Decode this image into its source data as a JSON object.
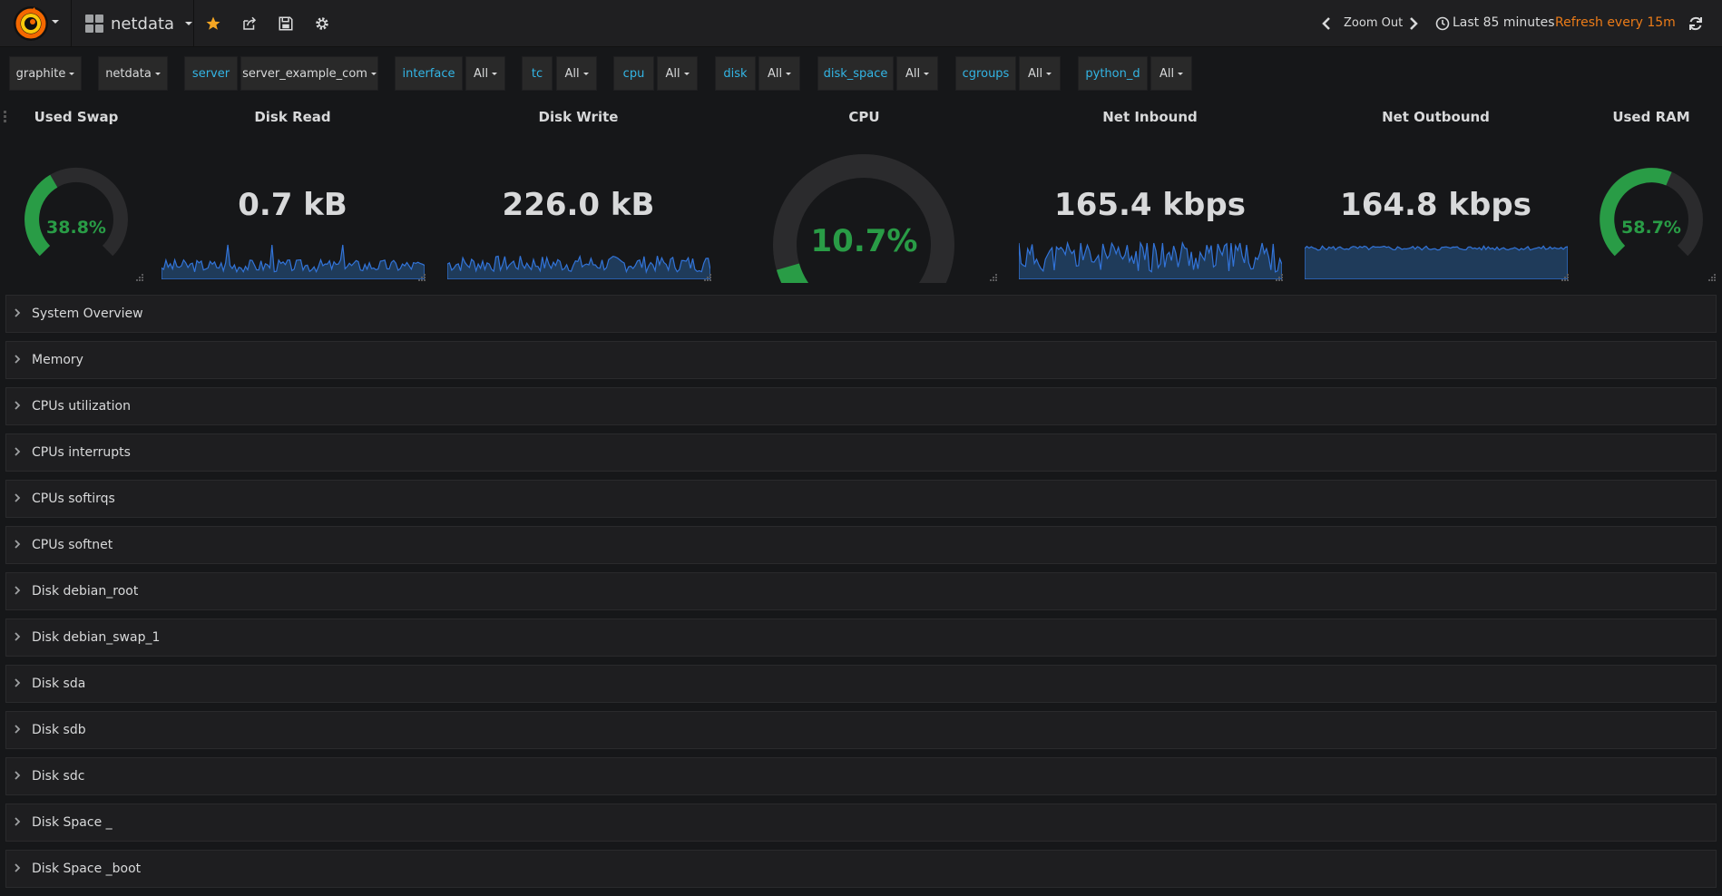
{
  "navbar": {
    "dashboard_title": "netdata",
    "zoom_out": "Zoom Out",
    "time_range": "Last 85 minutes",
    "refresh": "Refresh every 15m"
  },
  "variables": [
    {
      "text": "graphite",
      "type": "dropdown"
    },
    {
      "text": "netdata",
      "type": "dropdown"
    },
    {
      "text": "server",
      "type": "label"
    },
    {
      "text": "server_example_com",
      "type": "dropdown"
    },
    {
      "text": "interface",
      "type": "label"
    },
    {
      "text": "All",
      "type": "dropdown"
    },
    {
      "text": "tc",
      "type": "label"
    },
    {
      "text": "All",
      "type": "dropdown"
    },
    {
      "text": "cpu",
      "type": "label"
    },
    {
      "text": "All",
      "type": "dropdown"
    },
    {
      "text": "disk",
      "type": "label"
    },
    {
      "text": "All",
      "type": "dropdown"
    },
    {
      "text": "disk_space",
      "type": "label"
    },
    {
      "text": "All",
      "type": "dropdown"
    },
    {
      "text": "cgroups",
      "type": "label"
    },
    {
      "text": "All",
      "type": "dropdown"
    },
    {
      "text": "python_d",
      "type": "label"
    },
    {
      "text": "All",
      "type": "dropdown"
    }
  ],
  "panels": {
    "used_swap": {
      "title": "Used Swap",
      "value": "38.8%",
      "fraction": 0.388
    },
    "disk_read": {
      "title": "Disk Read",
      "value": "0.7 kB"
    },
    "disk_write": {
      "title": "Disk Write",
      "value": "226.0 kB"
    },
    "cpu": {
      "title": "CPU",
      "value": "10.7%",
      "fraction": 0.107
    },
    "net_inbound": {
      "title": "Net Inbound",
      "value": "165.4 kbps"
    },
    "net_outbound": {
      "title": "Net Outbound",
      "value": "164.8 kbps"
    },
    "used_ram": {
      "title": "Used RAM",
      "value": "58.7%",
      "fraction": 0.587
    }
  },
  "rows": [
    "System Overview",
    "Memory",
    "CPUs utilization",
    "CPUs interrupts",
    "CPUs softirqs",
    "CPUs softnet",
    "Disk debian_root",
    "Disk debian_swap_1",
    "Disk sda",
    "Disk sdb",
    "Disk sdc",
    "Disk Space _",
    "Disk Space _boot"
  ],
  "colors": {
    "accent_orange": "#eb7b18",
    "label_blue": "#33b5e5",
    "gauge_green": "#299c46",
    "gauge_track": "#2b2b2d",
    "spark_line": "#3274d9",
    "spark_fill": "#1f3b5a",
    "star": "#f5a623"
  },
  "icons": {
    "logo": "grafana-logo-icon",
    "star": "star-icon",
    "share": "share-icon",
    "save": "save-icon",
    "settings": "gear-icon",
    "clock": "clock-icon",
    "refresh": "refresh-icon"
  }
}
